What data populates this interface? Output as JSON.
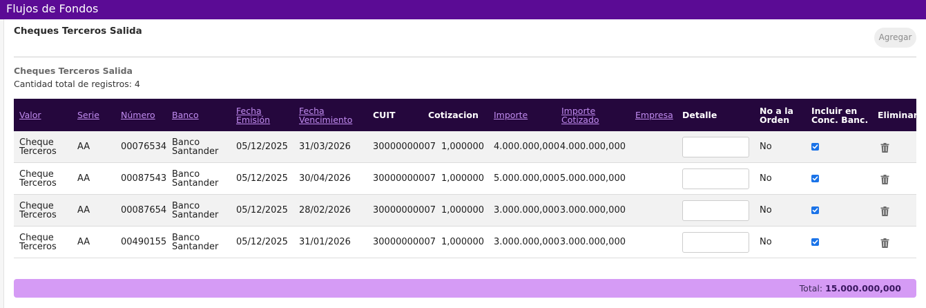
{
  "window": {
    "title": "Flujos de Fondos"
  },
  "section": {
    "title": "Cheques Terceros Salida",
    "add_label": "Agregar",
    "subtitle": "Cheques Terceros Salida",
    "count_text": "Cantidad total de registros: 4"
  },
  "columns": [
    {
      "label": "Valor",
      "sortable": true
    },
    {
      "label": "Serie",
      "sortable": true
    },
    {
      "label": "Número",
      "sortable": true
    },
    {
      "label": "Banco",
      "sortable": true
    },
    {
      "label": "Fecha Emisión",
      "sortable": true
    },
    {
      "label": "Fecha Vencimiento",
      "sortable": true
    },
    {
      "label": "CUIT",
      "sortable": false
    },
    {
      "label": "Cotizacion",
      "sortable": false
    },
    {
      "label": "Importe",
      "sortable": true
    },
    {
      "label": "Importe Cotizado",
      "sortable": true
    },
    {
      "label": "Empresa",
      "sortable": true
    },
    {
      "label": "Detalle",
      "sortable": false
    },
    {
      "label": "No a la Orden",
      "sortable": false
    },
    {
      "label": "Incluir en Conc. Banc.",
      "sortable": false
    },
    {
      "label": "Eliminar",
      "sortable": false
    }
  ],
  "rows": [
    {
      "valor": "Cheque Terceros",
      "serie": "AA",
      "numero": "00076534",
      "banco": "Banco Santander",
      "fecha_emision": "05/12/2025",
      "fecha_vencimiento": "31/03/2026",
      "cuit": "30000000007",
      "cotizacion": "1,000000",
      "importe": "4.000.000,000",
      "importe_cotizado": "4.000.000,000",
      "empresa": "",
      "detalle": "",
      "no_a_la_orden": "No",
      "incluir_conc_banc": true
    },
    {
      "valor": "Cheque Terceros",
      "serie": "AA",
      "numero": "00087543",
      "banco": "Banco Santander",
      "fecha_emision": "05/12/2025",
      "fecha_vencimiento": "30/04/2026",
      "cuit": "30000000007",
      "cotizacion": "1,000000",
      "importe": "5.000.000,000",
      "importe_cotizado": "5.000.000,000",
      "empresa": "",
      "detalle": "",
      "no_a_la_orden": "No",
      "incluir_conc_banc": true
    },
    {
      "valor": "Cheque Terceros",
      "serie": "AA",
      "numero": "00087654",
      "banco": "Banco Santander",
      "fecha_emision": "05/12/2025",
      "fecha_vencimiento": "28/02/2026",
      "cuit": "30000000007",
      "cotizacion": "1,000000",
      "importe": "3.000.000,000",
      "importe_cotizado": "3.000.000,000",
      "empresa": "",
      "detalle": "",
      "no_a_la_orden": "No",
      "incluir_conc_banc": true
    },
    {
      "valor": "Cheque Terceros",
      "serie": "AA",
      "numero": "00490155",
      "banco": "Banco Santander",
      "fecha_emision": "05/12/2025",
      "fecha_vencimiento": "31/01/2026",
      "cuit": "30000000007",
      "cotizacion": "1,000000",
      "importe": "3.000.000,000",
      "importe_cotizado": "3.000.000,000",
      "empresa": "",
      "detalle": "",
      "no_a_la_orden": "No",
      "incluir_conc_banc": true
    }
  ],
  "footer": {
    "total_label": "Total:",
    "total_value": "15.000.000,000"
  },
  "icons": {
    "delete": "trash-icon",
    "checkbox": "checkbox-checked-icon"
  },
  "colors": {
    "header_bar": "#5b0b95",
    "table_header": "#25073d",
    "link": "#c18cf0",
    "total_bar": "#d59bf5",
    "checkbox": "#1a73e8"
  }
}
